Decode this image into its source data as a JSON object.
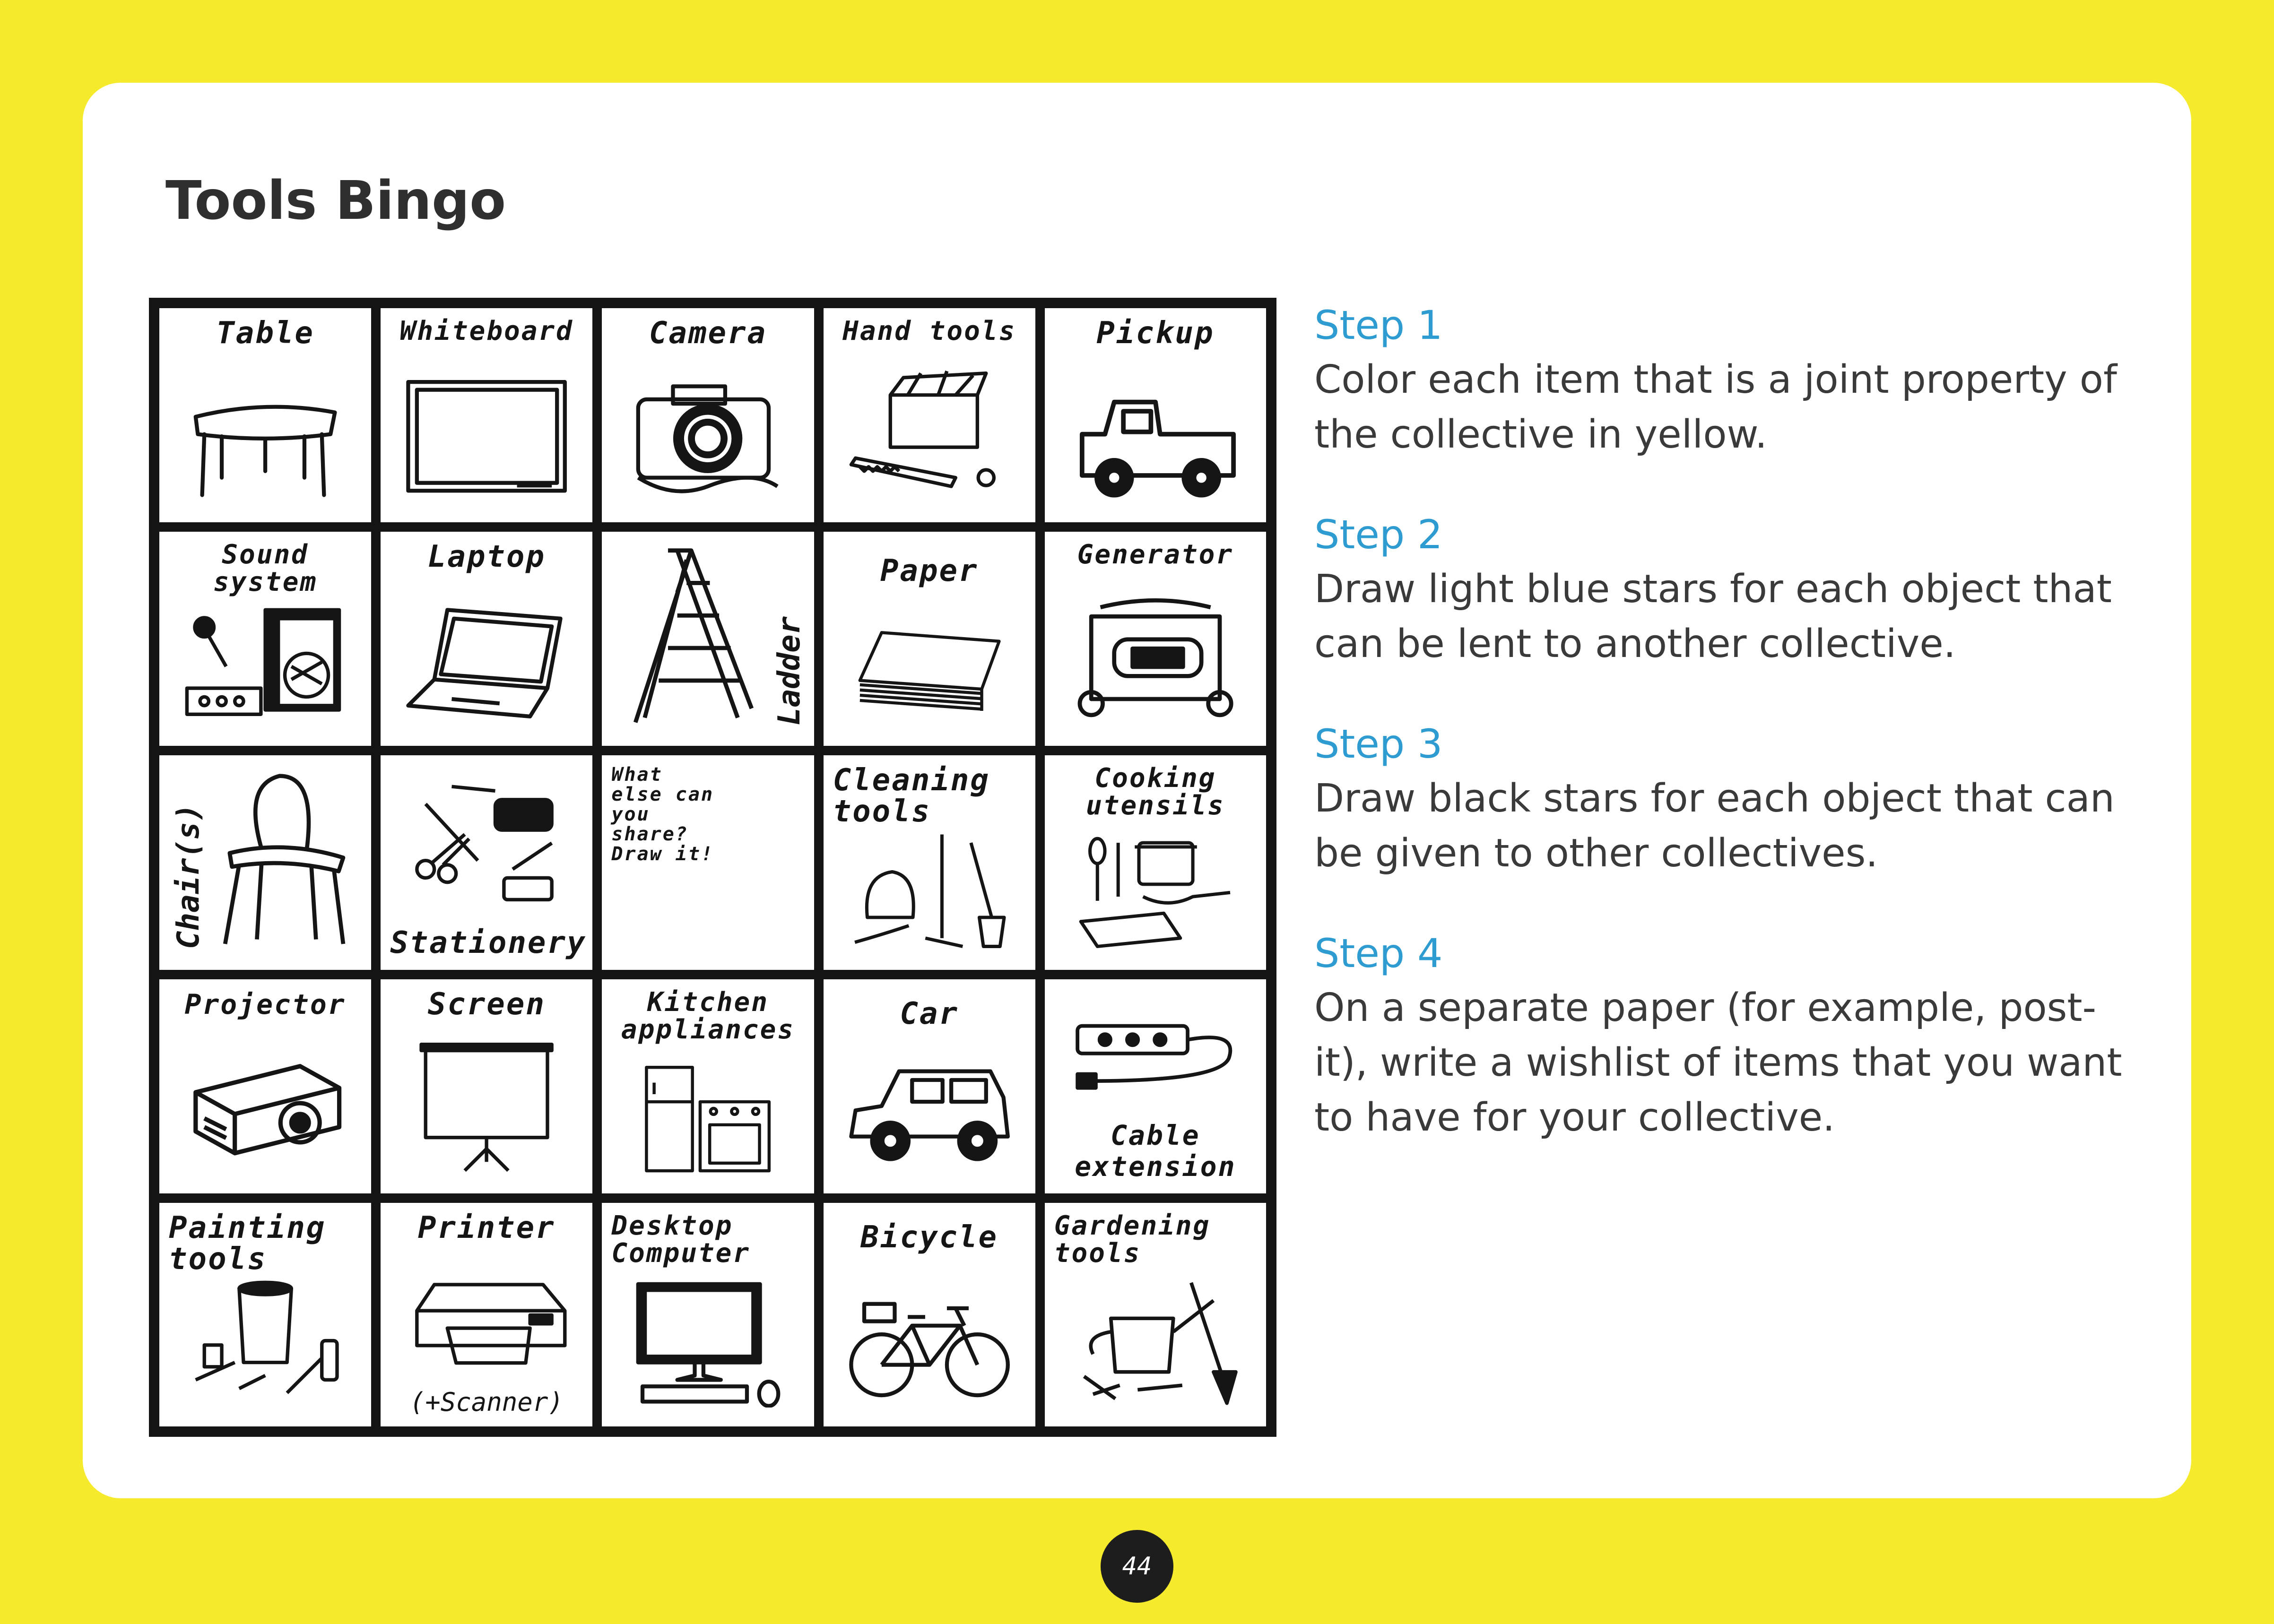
{
  "title": "Tools Bingo",
  "grid": [
    [
      {
        "label": "Table",
        "icon": "table-icon"
      },
      {
        "label": "Whiteboard",
        "icon": "whiteboard-icon"
      },
      {
        "label": "Camera",
        "icon": "camera-icon"
      },
      {
        "label": "Hand tools",
        "icon": "hand-tools-icon"
      },
      {
        "label": "Pickup",
        "icon": "pickup-truck-icon"
      }
    ],
    [
      {
        "label": "Sound system",
        "icon": "sound-system-icon"
      },
      {
        "label": "Laptop",
        "icon": "laptop-icon"
      },
      {
        "label": "Ladder",
        "icon": "ladder-icon"
      },
      {
        "label": "Paper",
        "icon": "paper-stack-icon"
      },
      {
        "label": "Generator",
        "icon": "generator-icon"
      }
    ],
    [
      {
        "label": "Chair(s)",
        "icon": "chair-icon"
      },
      {
        "label": "Stationery",
        "icon": "stationery-icon"
      },
      {
        "label": "What else can you share? Draw it!",
        "icon": ""
      },
      {
        "label": "Cleaning tools",
        "icon": "cleaning-tools-icon"
      },
      {
        "label": "Cooking utensils",
        "icon": "cooking-utensils-icon"
      }
    ],
    [
      {
        "label": "Projector",
        "icon": "projector-icon"
      },
      {
        "label": "Screen",
        "icon": "projection-screen-icon"
      },
      {
        "label": "Kitchen appliances",
        "icon": "kitchen-appliances-icon"
      },
      {
        "label": "Car",
        "icon": "car-icon"
      },
      {
        "label": "Cable extension",
        "icon": "power-strip-icon"
      }
    ],
    [
      {
        "label": "Painting tools",
        "icon": "painting-tools-icon"
      },
      {
        "label": "Printer",
        "sub": "(+Scanner)",
        "icon": "printer-icon"
      },
      {
        "label": "Desktop Computer",
        "icon": "desktop-computer-icon"
      },
      {
        "label": "Bicycle",
        "icon": "bicycle-icon"
      },
      {
        "label": "Gardening tools",
        "icon": "gardening-tools-icon"
      }
    ]
  ],
  "steps": [
    {
      "heading": "Step 1",
      "text": "Color each item that is a joint property of the collective in yellow."
    },
    {
      "heading": "Step 2",
      "text": "Draw light blue stars for each object that can be lent to another collective."
    },
    {
      "heading": "Step 3",
      "text": "Draw black stars for each object that can be given to other collectives."
    },
    {
      "heading": "Step 4",
      "text": "On a separate paper (for example, post-it), write a wishlist of items that you want to have for your collective."
    }
  ],
  "page_number": "44",
  "colors": {
    "background": "#f5ea2c",
    "card": "#ffffff",
    "step_heading": "#2e9bd1",
    "ink": "#141414"
  }
}
